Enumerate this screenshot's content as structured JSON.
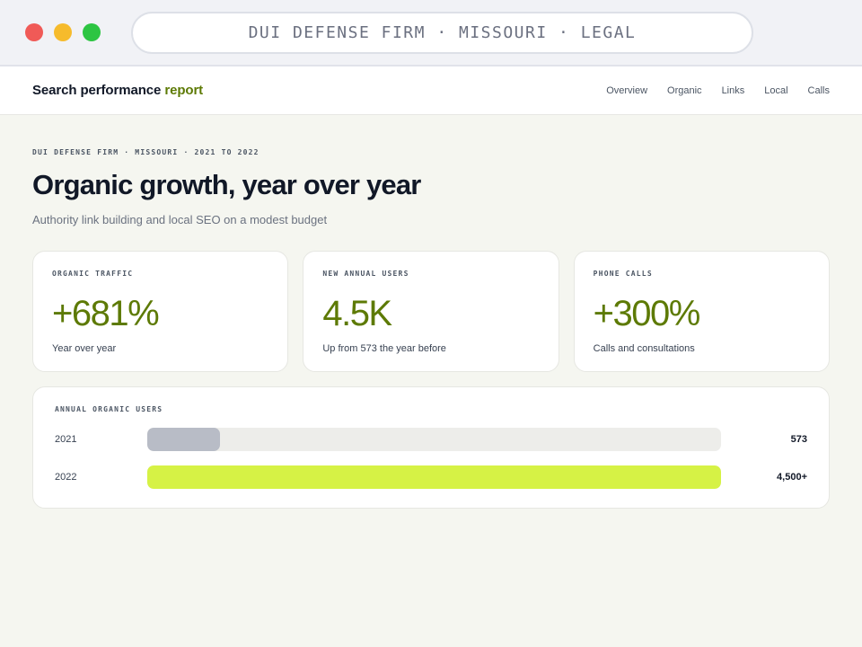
{
  "browser": {
    "url_text": "DUI DEFENSE FIRM · MISSOURI · LEGAL",
    "colors": {
      "close": "#f05a57",
      "minimize": "#f6bb2c",
      "maximize": "#2dc542"
    }
  },
  "header": {
    "brand_main": "Search performance",
    "brand_accent": "report",
    "nav": [
      "Overview",
      "Organic",
      "Links",
      "Local",
      "Calls"
    ]
  },
  "page": {
    "eyebrow": "DUI DEFENSE FIRM · MISSOURI · 2021 TO 2022",
    "title": "Organic growth, year over year",
    "subtitle": "Authority link building and local SEO on a modest budget"
  },
  "stats": [
    {
      "label": "ORGANIC TRAFFIC",
      "value": "+681%",
      "note": "Year over year"
    },
    {
      "label": "NEW ANNUAL USERS",
      "value": "4.5K",
      "note": "Up from 573 the year before"
    },
    {
      "label": "PHONE CALLS",
      "value": "+300%",
      "note": "Calls and consultations"
    }
  ],
  "annual_users": {
    "label": "ANNUAL ORGANIC USERS",
    "rows": [
      {
        "year": "2021",
        "value_label": "573",
        "fill_fraction": 0.127,
        "color": "#b8bcc6"
      },
      {
        "year": "2022",
        "value_label": "4,500+",
        "fill_fraction": 1.0,
        "color": "#d6f245"
      }
    ]
  },
  "colors": {
    "accent": "#5d7a05",
    "lime": "#d6f245",
    "background": "#f5f6f0"
  }
}
